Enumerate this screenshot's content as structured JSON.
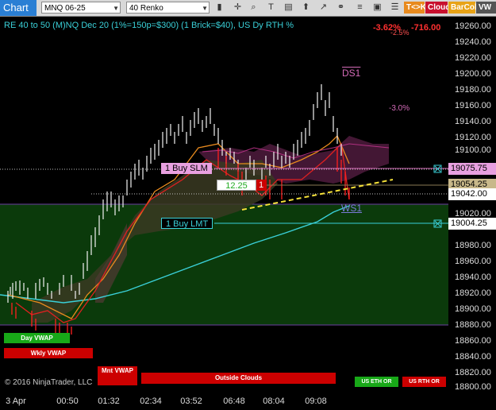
{
  "toolbar": {
    "title": "Chart",
    "instrument": "MNQ 06-25",
    "interval": "40 Renko",
    "icons": [
      "bar-style-icon",
      "crosshair-icon",
      "zoom-icon",
      "text-icon",
      "properties-icon",
      "draw-icon",
      "strategy-icon",
      "link-icon",
      "more-icon"
    ],
    "btn_tk": "T<>K",
    "btn_cloud": "Cloud",
    "btn_barcol": "BarCol",
    "btn_last": "VW",
    "colors": {
      "tk": "#e88a1e",
      "cloud": "#c8102e",
      "barcol": "#e8a317"
    }
  },
  "header": {
    "title": "RE 40 to 50 (M)NQ Dec 20 (1%=150p=$300) (1 Brick=$40), US Dy RTH %",
    "pnl_pct": "-3.62%",
    "pnl_pct_small": "-2.5%",
    "pnl_usd": "-716.00"
  },
  "yaxis": {
    "ticks": [
      "19260.00",
      "19240.00",
      "19220.00",
      "19200.00",
      "19180.00",
      "19160.00",
      "19140.00",
      "19120.00",
      "19100.00",
      "19080.00",
      "19060.00",
      "19040.00",
      "19020.00",
      "19000.00",
      "18980.00",
      "18960.00",
      "18940.00",
      "18920.00",
      "18900.00",
      "18880.00",
      "18860.00",
      "18840.00",
      "18820.00",
      "18800.00"
    ],
    "tag_buy_slm": "19075.75",
    "tag_mid": "19054.25",
    "tag_last": "19042.00",
    "tag_buy_lmt": "19004.25"
  },
  "xaxis": {
    "ticks": [
      "3 Apr",
      "00:50",
      "01:32",
      "02:34",
      "03:52",
      "06:48",
      "08:04",
      "09:08"
    ]
  },
  "orders": {
    "buy_slm": "1 Buy SLM",
    "buy_lmt": "1 Buy LMT",
    "position_pnl": "12.25",
    "position_qty": "1"
  },
  "annotations": {
    "ds1": "DS1",
    "ws1": "WS1",
    "pct": "-3.0%"
  },
  "bottom": {
    "day_vwap": "Day VWAP",
    "wkly_vwap": "Wkly VWAP",
    "mnt_vwap": "Mnt VWAP",
    "outside_clouds": "Outside Clouds",
    "us_eth_or": "US ETH OR",
    "us_rth_or": "US RTH OR",
    "copyright": "© 2016 NinjaTrader, LLC"
  }
}
